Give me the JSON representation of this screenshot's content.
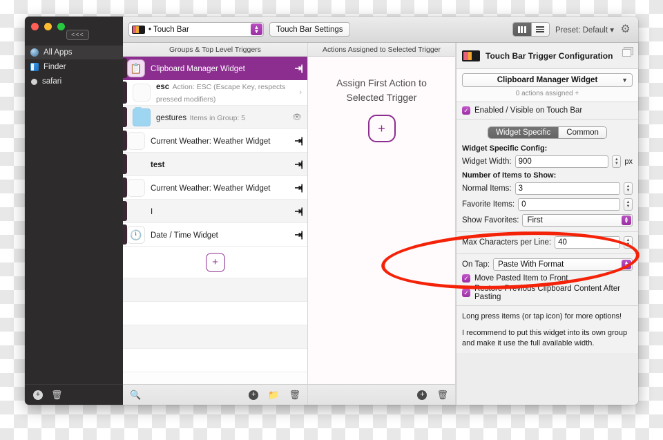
{
  "titlebar": {
    "preset_dropdown_value": "• Touch Bar",
    "touch_bar_settings_label": "Touch Bar Settings",
    "preset_label": "Preset: Default ▾",
    "gear_icon": "gear-icon",
    "view_icon_columns": "columns-view-icon",
    "view_icon_list": "list-view-icon"
  },
  "sidebar": {
    "collapse_label": "<<<",
    "items": [
      {
        "label": "All Apps",
        "icon": "globe-icon",
        "selected": true
      },
      {
        "label": "Finder",
        "icon": "finder-icon",
        "selected": false
      },
      {
        "label": "safari",
        "icon": "dot-icon",
        "selected": false
      }
    ],
    "footer": {
      "add_icon": "plus-circle-icon",
      "delete_icon": "trash-icon"
    }
  },
  "groups_column": {
    "header": "Groups & Top Level Triggers",
    "rows": [
      {
        "title": "Clipboard Manager Widget",
        "subtitle": "",
        "icon": "clipboard-icon",
        "selected": true,
        "right": "arrow-in-icon"
      },
      {
        "title": "esc",
        "subtitle": "Action: ESC (Escape Key, respects pressed modifiers)",
        "icon": "blank-icon",
        "selected": false,
        "right": "chevron-right-icon",
        "bold_title": true,
        "sub": true
      },
      {
        "title": "gestures",
        "subtitle": "Items in Group: 5",
        "icon": "folder-icon",
        "selected": false,
        "right": "eye-icon",
        "sub": true
      },
      {
        "title": "Current Weather: Weather Widget",
        "subtitle": "",
        "icon": "blank-icon",
        "selected": false,
        "right": "arrow-in-icon"
      },
      {
        "title": "test",
        "subtitle": "",
        "icon": "none",
        "selected": false,
        "right": "arrow-in-icon",
        "bold_title": true
      },
      {
        "title": "Current Weather: Weather Widget",
        "subtitle": "",
        "icon": "blank-icon",
        "selected": false,
        "right": "arrow-in-icon"
      },
      {
        "title": "I",
        "subtitle": "",
        "icon": "none",
        "selected": false,
        "right": "arrow-in-icon"
      },
      {
        "title": "Date / Time Widget",
        "subtitle": "",
        "icon": "clock-icon",
        "selected": false,
        "right": "arrow-in-icon"
      }
    ],
    "add_button_label": "+",
    "footer": {
      "search_icon": "search-icon",
      "add_icon": "plus-circle-icon",
      "new_group_icon": "new-folder-icon",
      "delete_icon": "trash-icon"
    }
  },
  "actions_column": {
    "header": "Actions Assigned to Selected Trigger",
    "empty_message_line1": "Assign First Action to",
    "empty_message_line2": "Selected Trigger",
    "add_button_label": "+",
    "footer": {
      "add_icon": "plus-circle-icon",
      "delete_icon": "trash-icon"
    }
  },
  "config_panel": {
    "header_title": "Touch Bar Trigger Configuration",
    "header_icon": "touch-bar-icon",
    "detach_icon": "detach-window-icon",
    "widget_select_value": "Clipboard Manager Widget",
    "actions_assigned": "0 actions assigned +",
    "enabled_label": "Enabled / Visible on Touch Bar",
    "enabled_checked": true,
    "tabs": [
      {
        "label": "Widget Specific",
        "active": true
      },
      {
        "label": "Common",
        "active": false
      }
    ],
    "widget_specific_config_label": "Widget Specific Config:",
    "widget_width_label": "Widget Width:",
    "widget_width_value": "900",
    "widget_width_unit": "px",
    "number_of_items_label": "Number of Items to Show:",
    "normal_items_label": "Normal Items:",
    "normal_items_value": "3",
    "favorite_items_label": "Favorite Items:",
    "favorite_items_value": "0",
    "show_favorites_label": "Show Favorites:",
    "show_favorites_value": "First",
    "max_chars_label": "Max Characters per Line:",
    "max_chars_value": "40",
    "on_tap_label": "On Tap:",
    "on_tap_value": "Paste With Format",
    "move_pasted_label": "Move Pasted Item to Front",
    "move_pasted_checked": true,
    "restore_clipboard_label": "Restore Previous Clipboard Content After Pasting",
    "restore_clipboard_checked": true,
    "note1": "Long press items (or tap icon) for more options!",
    "note2": "I recommend to put this widget into its own group and make it use the full available width."
  },
  "annotation": {
    "shape": "red-ellipse-highlight",
    "color": "#f42208"
  }
}
